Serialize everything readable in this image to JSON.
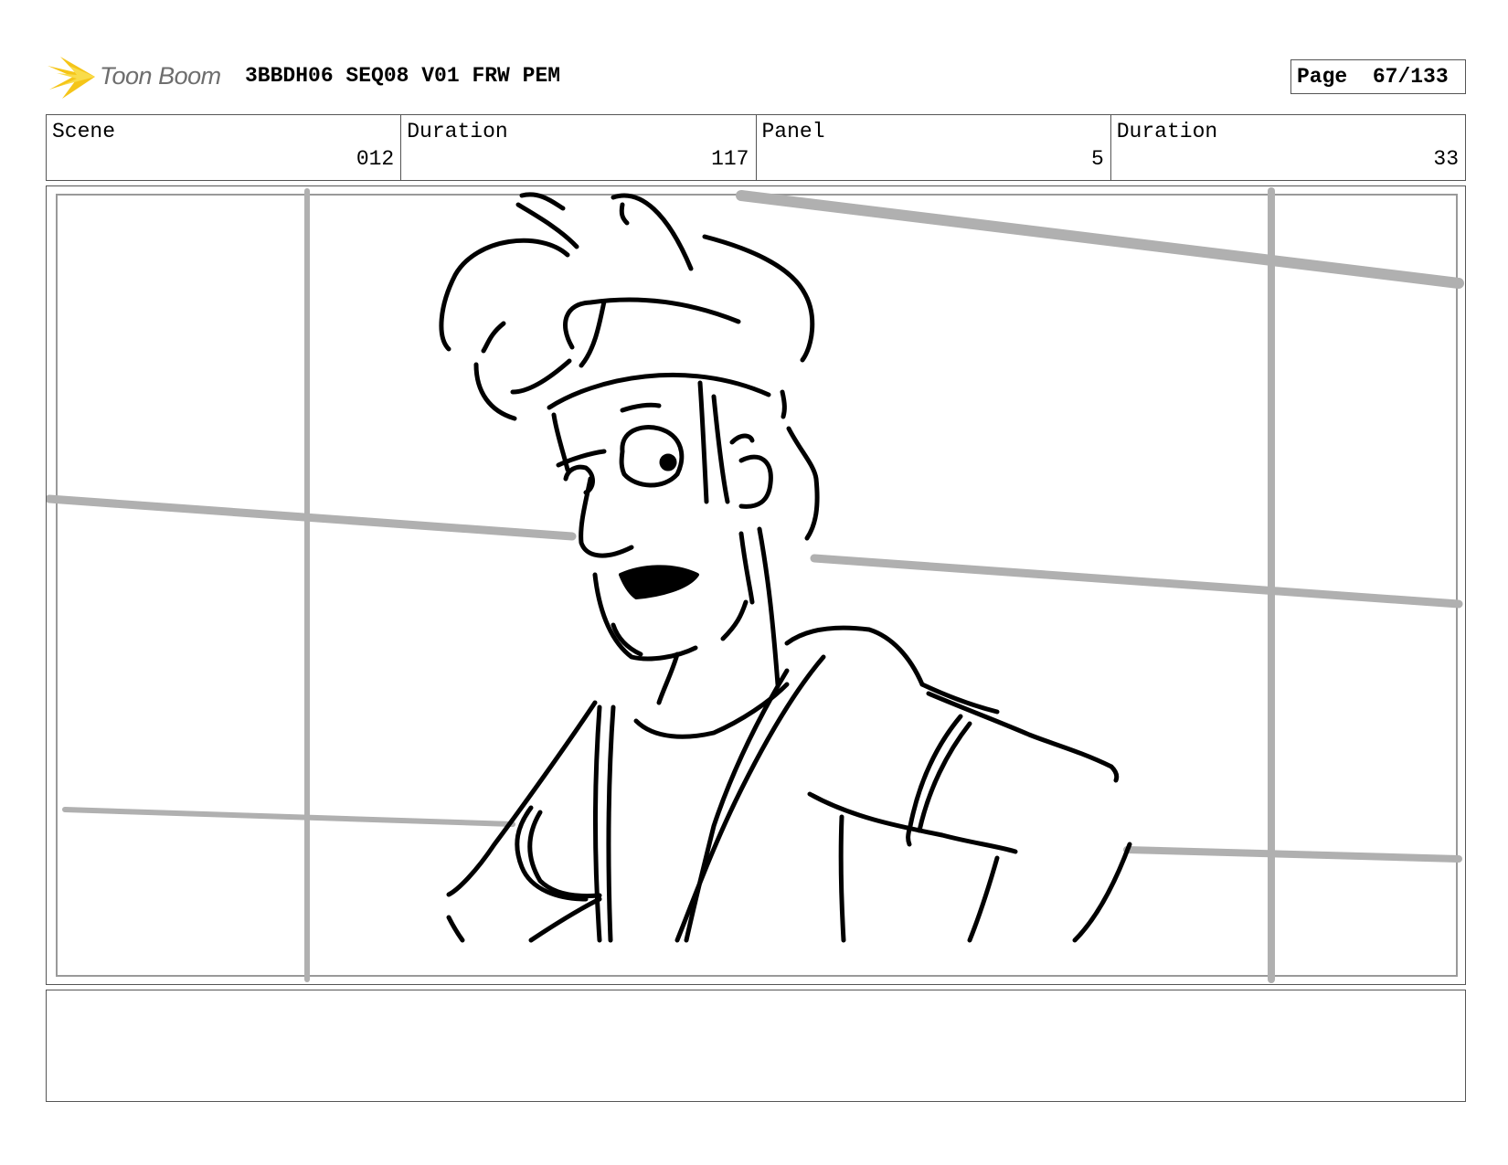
{
  "header": {
    "brand": "Toon Boom",
    "document_title": "3BBDH06 SEQ08 V01 FRW PEM",
    "page_label": "Page",
    "page_number": "67/133"
  },
  "info": {
    "scene_label": "Scene",
    "scene_value": "012",
    "scene_duration_label": "Duration",
    "scene_duration_value": "117",
    "panel_label": "Panel",
    "panel_value": "5",
    "panel_duration_label": "Duration",
    "panel_duration_value": "33"
  },
  "colors": {
    "logo_star": "#f5c518",
    "logo_text": "#6e6e6e",
    "border": "#555555",
    "sketch_line": "#000000",
    "background_grid": "#b0b0b0"
  },
  "notes": {
    "text": ""
  }
}
